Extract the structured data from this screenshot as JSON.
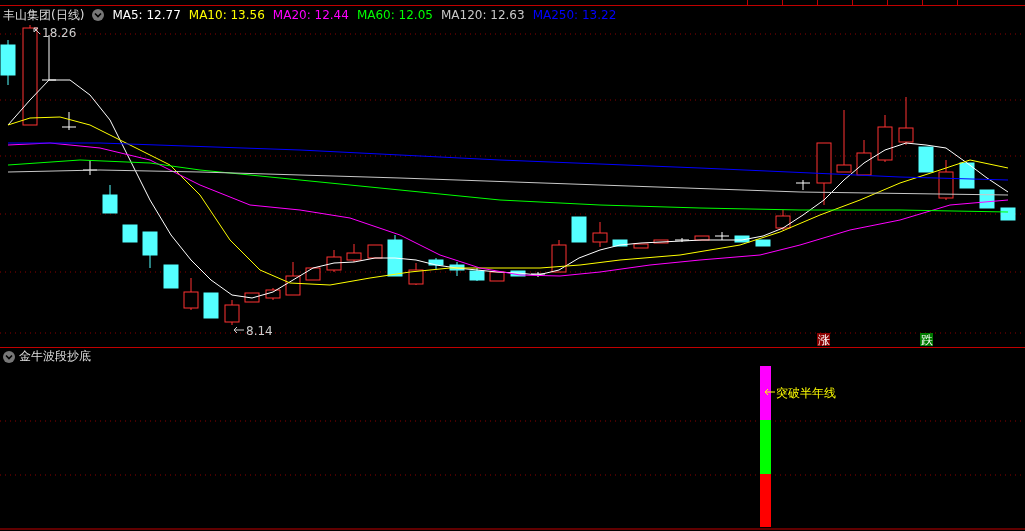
{
  "main_panel": {
    "title": "丰山集团(日线)",
    "indicators": [
      {
        "label": "MA5: 12.77",
        "color": "#ffffff"
      },
      {
        "label": "MA10: 13.56",
        "color": "#ffff00"
      },
      {
        "label": "MA20: 12.44",
        "color": "#ff00ff"
      },
      {
        "label": "MA60: 12.05",
        "color": "#00ff00"
      },
      {
        "label": "MA120: 12.63",
        "color": "#c8c8c8"
      },
      {
        "label": "MA250: 13.22",
        "color": "#0000ff"
      }
    ],
    "high_label": "18.26",
    "low_label": "8.14",
    "badges": [
      {
        "text": "涨",
        "kind": "rise"
      },
      {
        "text": "跌",
        "kind": "fall"
      }
    ]
  },
  "sub_panel": {
    "title": "金牛波段抄底",
    "annotation": "突破半年线"
  }
}
